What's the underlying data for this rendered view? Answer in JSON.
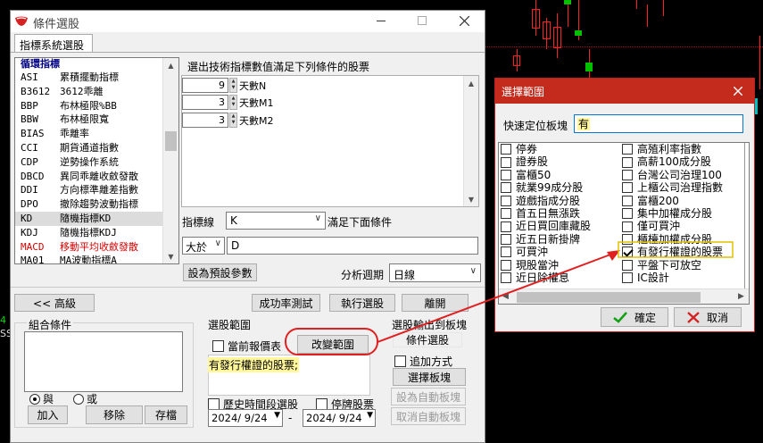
{
  "main": {
    "title": "條件選股",
    "tab": "指標系統選股",
    "list_header": "循環指標",
    "indicators": [
      {
        "code": "ASI",
        "name": "累積擺動指標",
        "red": false
      },
      {
        "code": "B3612",
        "name": "3612乖離",
        "red": false
      },
      {
        "code": "BBP",
        "name": "布林極限%BB",
        "red": false
      },
      {
        "code": "BBW",
        "name": "布林極限寬",
        "red": false
      },
      {
        "code": "BIAS",
        "name": "乖離率",
        "red": false
      },
      {
        "code": "CCI",
        "name": "期貨通道指數",
        "red": false
      },
      {
        "code": "CDP",
        "name": "逆勢操作系統",
        "red": false
      },
      {
        "code": "DBCD",
        "name": "異同乖離收斂發散",
        "red": false
      },
      {
        "code": "DDI",
        "name": "方向標準離差指數",
        "red": false
      },
      {
        "code": "DPO",
        "name": "撤除趨勢波動指標",
        "red": false
      },
      {
        "code": "KD",
        "name": "隨機指標KD",
        "red": false
      },
      {
        "code": "KDJ",
        "name": "隨機指標KDJ",
        "red": false
      },
      {
        "code": "MACD",
        "name": "移動平均收斂發散",
        "red": true
      },
      {
        "code": "MA01",
        "name": "MA波動指標A",
        "red": false
      }
    ],
    "description": "選出技術指標數值滿足下列條件的股票",
    "params": [
      {
        "value": "9",
        "label": "天數N"
      },
      {
        "value": "3",
        "label": "天數M1"
      },
      {
        "value": "3",
        "label": "天數M2"
      }
    ],
    "indicator_line_label": "指標線",
    "indicator_line_value": "K",
    "satisfy_label": "滿足下面條件",
    "operator_value": "大於",
    "operand_value": "D",
    "set_default_button": "設為預設參數",
    "period_label": "分析週期",
    "period_value": "日線",
    "advanced_button": "<< 高級",
    "success_test_button": "成功率測試",
    "execute_button": "執行選股",
    "leave_button": "離開",
    "combo_label": "組合條件",
    "radio_and": "與",
    "radio_or": "或",
    "add_button": "加入",
    "remove_button": "移除",
    "save_button": "存檔",
    "range_label": "選股範圍",
    "current_quote_label": "當前報價表",
    "change_range_button": "改變範圍",
    "range_text": "有發行權證的股票;",
    "history_label": "歷史時間段選股",
    "suspended_label": "停牌股票",
    "date_from": "2024/ 9/24",
    "date_sep": "-",
    "date_to": "2024/ 9/24",
    "output_label": "選股輸出到板塊",
    "output_sub": "條件選股",
    "append_label": "追加方式",
    "select_board_button": "選擇板塊",
    "set_auto_board_button": "設為自動板塊",
    "cancel_auto_board_button": "取消自動板塊",
    "side_markers": [
      "4",
      "SS"
    ]
  },
  "dialog": {
    "title": "選擇範圍",
    "quick_label": "快速定位板塊",
    "quick_value": "有",
    "col1": [
      {
        "label": "停券",
        "checked": false
      },
      {
        "label": "證券股",
        "checked": false
      },
      {
        "label": "富櫃50",
        "checked": false
      },
      {
        "label": "就業99成分股",
        "checked": false
      },
      {
        "label": "遊戲指成分股",
        "checked": false
      },
      {
        "label": "首五日無漲跌",
        "checked": false
      },
      {
        "label": "近日買回庫藏股",
        "checked": false
      },
      {
        "label": "近五日新掛牌",
        "checked": false
      },
      {
        "label": "可買沖",
        "checked": false
      },
      {
        "label": "現股當沖",
        "checked": false
      },
      {
        "label": "近日除權息",
        "checked": false
      }
    ],
    "col2": [
      {
        "label": "高殖利率指數",
        "checked": false
      },
      {
        "label": "高薪100成分股",
        "checked": false
      },
      {
        "label": "台灣公司治理100",
        "checked": false
      },
      {
        "label": "上櫃公司治理指數",
        "checked": false
      },
      {
        "label": "富櫃200",
        "checked": false
      },
      {
        "label": "集中加權成分股",
        "checked": false
      },
      {
        "label": "僅可買沖",
        "checked": false
      },
      {
        "label": "櫃檯加權成分股",
        "checked": false
      },
      {
        "label": "有發行權證的股票",
        "checked": true
      },
      {
        "label": "平盤下可放空",
        "checked": false
      },
      {
        "label": "IC設計",
        "checked": false
      }
    ],
    "ok_button": "確定",
    "cancel_button": "取消"
  },
  "colors": {
    "accent_red": "#d42020",
    "dialog_title": "#c42b1c",
    "highlight": "#fff79a",
    "arrow": "#e02020"
  }
}
